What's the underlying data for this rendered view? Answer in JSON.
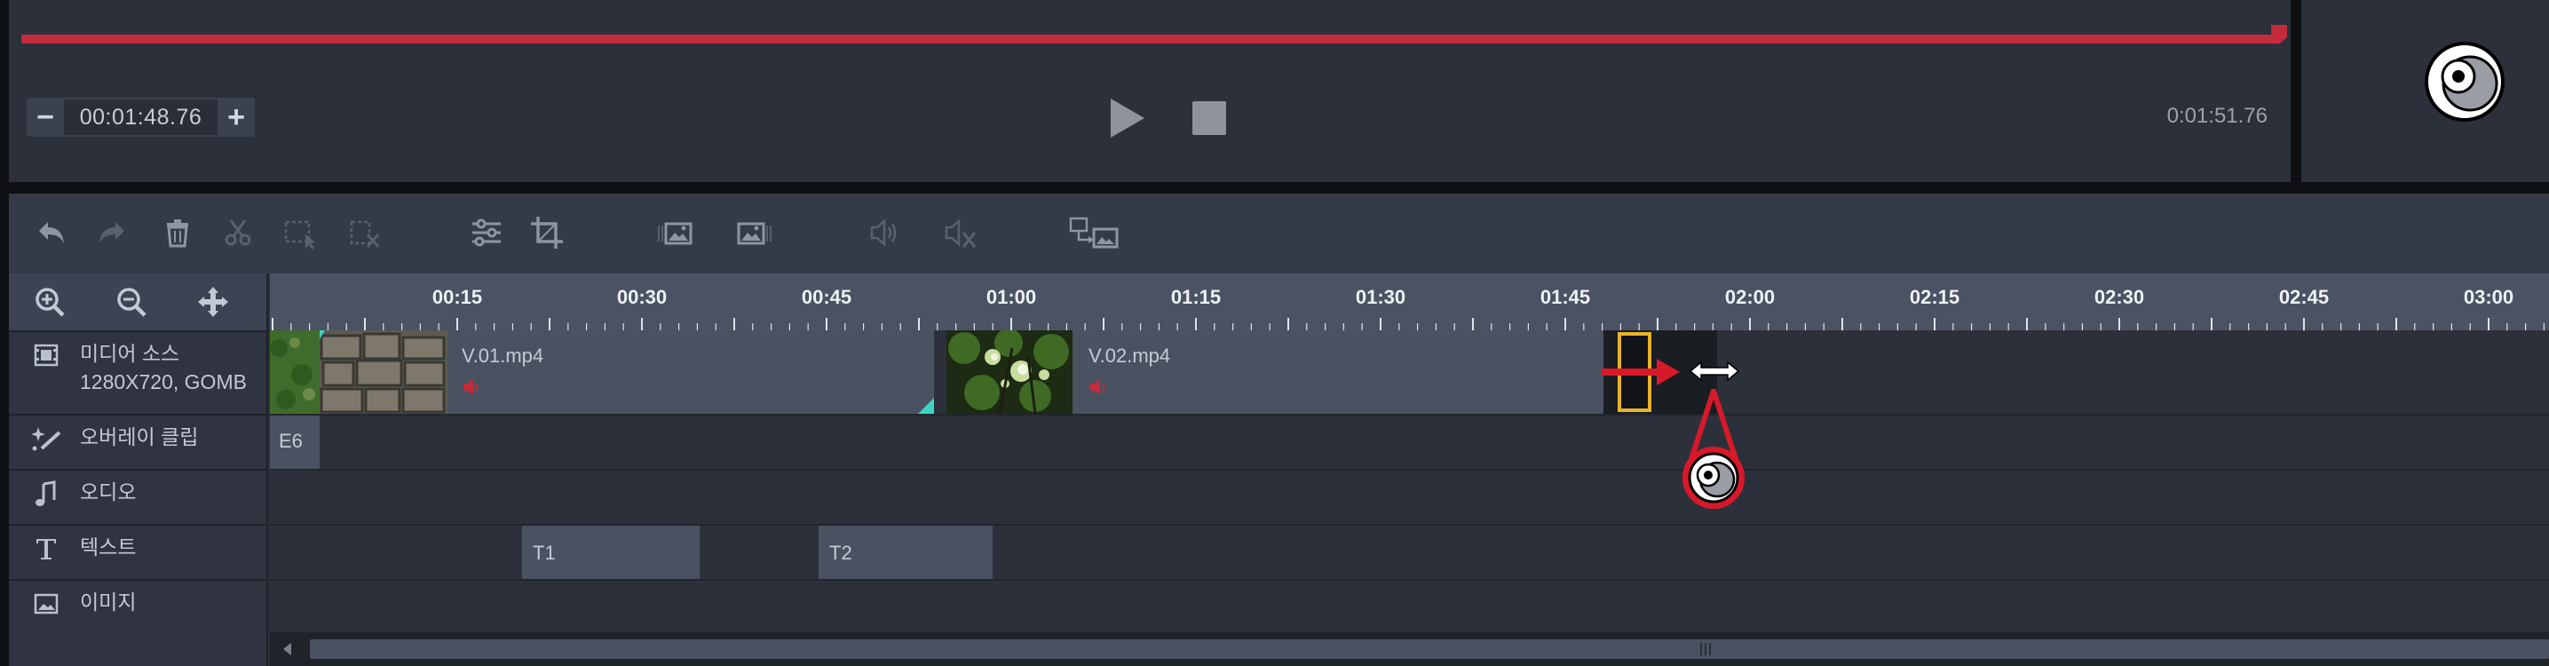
{
  "player": {
    "current_time": "00:01:48.76",
    "total_time": "0:01:51.76",
    "progress": 0.973,
    "minus_label": "−",
    "plus_label": "+"
  },
  "toolbar": {
    "tools": [
      "undo-icon",
      "redo-icon",
      "delete-icon",
      "cut-icon",
      "select-region-icon",
      "remove-region-icon",
      "adjust-icon",
      "crop-icon",
      "image-before-icon",
      "image-after-icon",
      "audio-icon",
      "mute-icon",
      "replace-image-icon"
    ]
  },
  "timeline": {
    "ruler_labels": [
      "00:15",
      "00:30",
      "00:45",
      "01:00",
      "01:15",
      "01:30",
      "01:45",
      "02:00",
      "02:15",
      "02:30",
      "02:45",
      "03:00"
    ],
    "tracks": [
      {
        "name": "미디어 소스",
        "sub": "1280X720, GOMB",
        "icon": "film-icon"
      },
      {
        "name": "오버레이 클립",
        "sub": "",
        "icon": "sparkle-icon"
      },
      {
        "name": "오디오",
        "sub": "",
        "icon": "music-note-icon"
      },
      {
        "name": "텍스트",
        "sub": "",
        "icon": "text-icon"
      },
      {
        "name": "이미지",
        "sub": "",
        "icon": "image-icon"
      }
    ],
    "clips": {
      "video1": "V.01.mp4",
      "video2": "V.02.mp4",
      "overlay": "E6",
      "text1": "T1",
      "text2": "T2"
    }
  },
  "colors": {
    "accent_red": "#c42b3c",
    "trim_yellow": "#e8b32a",
    "panel": "#2c303b"
  }
}
